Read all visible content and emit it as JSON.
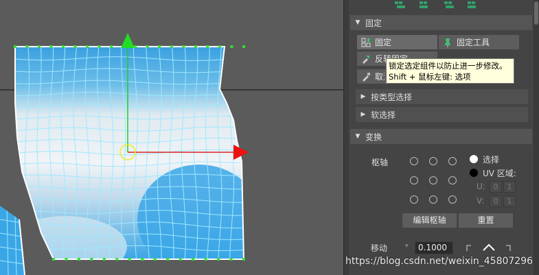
{
  "pin_section": {
    "title": "固定",
    "buttons": {
      "pin": "固定",
      "pin_tool": "固定工具",
      "invert_pin": "反转固定",
      "unpin": "取消固定"
    }
  },
  "tooltip": {
    "line1": "锁定选定组件以防止进一步修改。",
    "line2": "Shift + 鼠标左键: 选项"
  },
  "collapsed_sections": {
    "select_by_type": "按类型选择",
    "soft_select": "软选择"
  },
  "transform_section": {
    "title": "变换",
    "pivot_label": "枢轴",
    "option_select": "选择",
    "option_uv_domain": "UV 区域:",
    "u_label": "U:",
    "v_label": "V:",
    "u_values": [
      "0",
      "1"
    ],
    "v_values": [
      "0",
      "1"
    ],
    "edit_pivot_button": "编辑枢轴",
    "reset_button": "重置",
    "move_label": "移动",
    "move_value": "0.1000"
  },
  "watermark": "https://blog.csdn.net/weixin_45807296",
  "colors": {
    "uv_fill_top": "#3aa0e0",
    "uv_fill_mid": "#e8eef2",
    "wireframe": "#9fe8ff",
    "manip_y": "#22cc22",
    "manip_x": "#dd2222",
    "tooltip_bg": "#ffffdc"
  }
}
